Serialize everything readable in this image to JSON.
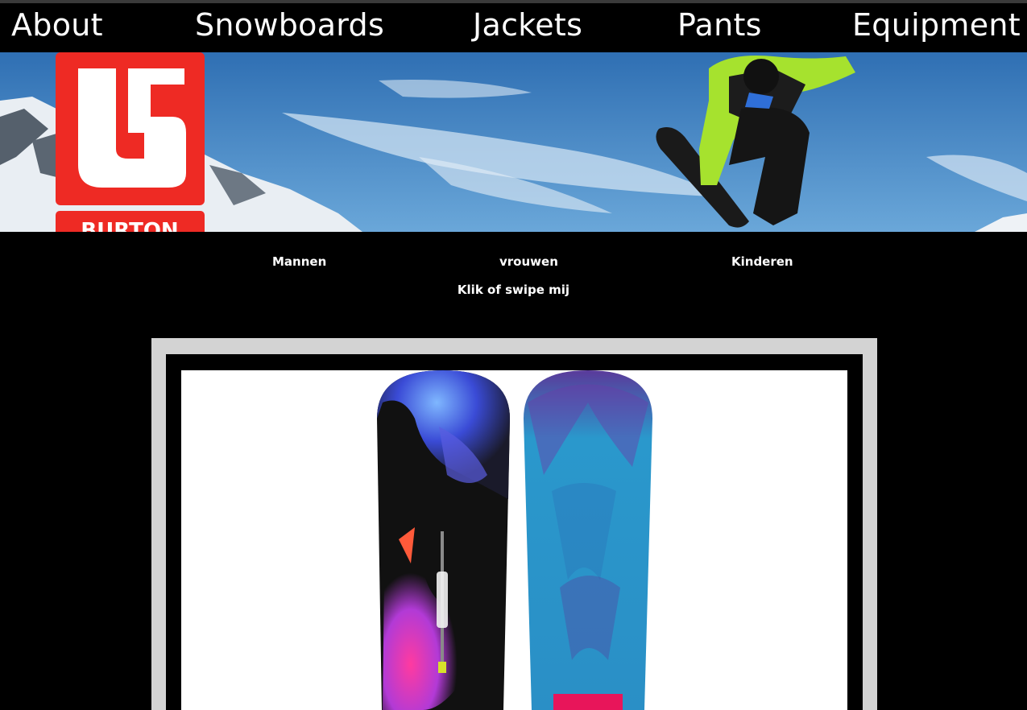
{
  "nav": {
    "items": [
      {
        "label": "About"
      },
      {
        "label": "Snowboards"
      },
      {
        "label": "Jackets"
      },
      {
        "label": "Pants"
      },
      {
        "label": "Equipment"
      }
    ]
  },
  "brand": {
    "logo_text": "BURTON",
    "logo_color": "#ee2a24"
  },
  "categories": {
    "items": [
      {
        "label": "Mannen"
      },
      {
        "label": "vrouwen"
      },
      {
        "label": "Kinderen"
      }
    ],
    "hint": "Klik of swipe mij"
  },
  "colors": {
    "background": "#000000",
    "frame": "#d3d3d3",
    "sky": "#3f86c8",
    "jacket": "#a6e22e",
    "board_base_blue": "#1f8fc4",
    "board_purple": "#6a3ca8"
  }
}
